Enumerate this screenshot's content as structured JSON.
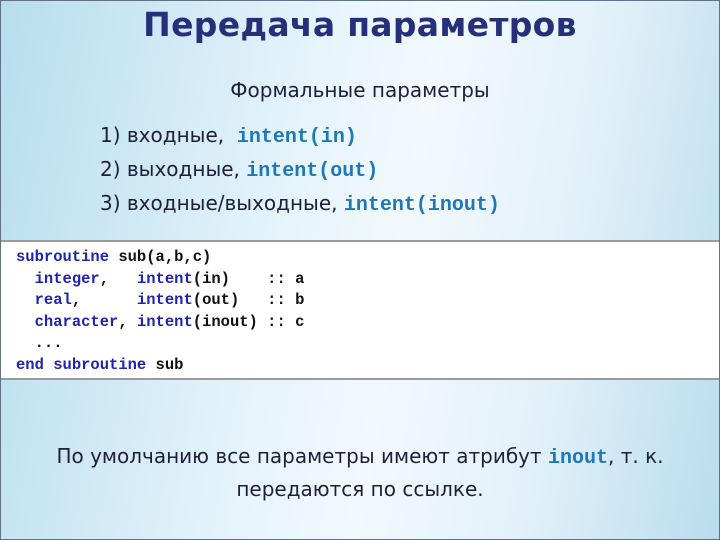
{
  "title": "Передача параметров",
  "subtitle": "Формальные параметры",
  "list": [
    {
      "num": "1)",
      "text": "входные,",
      "gap": "  ",
      "code": "intent(in)"
    },
    {
      "num": "2)",
      "text": "выходные,",
      "gap": " ",
      "code": "intent(out)"
    },
    {
      "num": "3)",
      "text": "входные/выходные,",
      "gap": " ",
      "code": "intent(inout)"
    }
  ],
  "code_block": {
    "lines": [
      [
        {
          "t": "subroutine",
          "kw": true
        },
        {
          "t": " sub(a,b,c)",
          "kw": false
        }
      ],
      [
        {
          "t": "  ",
          "kw": false
        },
        {
          "t": "integer",
          "kw": true
        },
        {
          "t": ",   ",
          "kw": false
        },
        {
          "t": "intent",
          "kw": true
        },
        {
          "t": "(in)    :: a",
          "kw": false
        }
      ],
      [
        {
          "t": "  ",
          "kw": false
        },
        {
          "t": "real",
          "kw": true
        },
        {
          "t": ",      ",
          "kw": false
        },
        {
          "t": "intent",
          "kw": true
        },
        {
          "t": "(out)   :: b",
          "kw": false
        }
      ],
      [
        {
          "t": "  ",
          "kw": false
        },
        {
          "t": "character",
          "kw": true
        },
        {
          "t": ", ",
          "kw": false
        },
        {
          "t": "intent",
          "kw": true
        },
        {
          "t": "(inout) :: c",
          "kw": false
        }
      ],
      [
        {
          "t": "  ...",
          "kw": false
        }
      ],
      [
        {
          "t": "end",
          "kw": true
        },
        {
          "t": " ",
          "kw": false
        },
        {
          "t": "subroutine",
          "kw": true
        },
        {
          "t": " sub",
          "kw": false
        }
      ]
    ]
  },
  "note": {
    "before": "По умолчанию все параметры имеют атрибут ",
    "code": "inout",
    "after": ", т. к. передаются по ссылке."
  },
  "colors": {
    "title": "#26307a",
    "inline_code": "#1d78b8",
    "keyword": "#1f24b0"
  }
}
